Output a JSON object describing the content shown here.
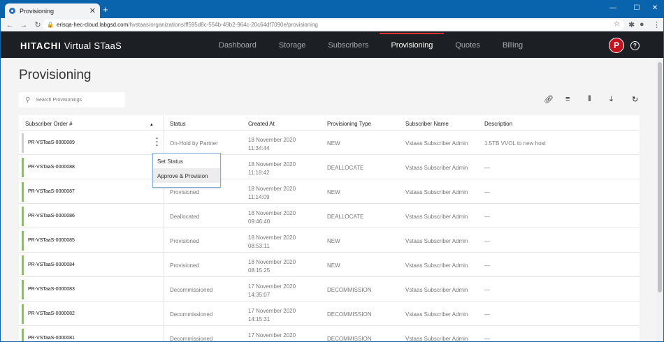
{
  "browser": {
    "tab_title": "Provisioning",
    "address_host": "erisqa-hec-cloud.labgsd.com",
    "address_path": "/hvstaas/organizations/ff595d8c-554b-49b2-964c-20c64df7090e/provisioning"
  },
  "app": {
    "brand": "HITACHI",
    "product": "Virtual STaaS",
    "nav": [
      "Dashboard",
      "Storage",
      "Subscribers",
      "Provisioning",
      "Quotes",
      "Billing"
    ],
    "active_nav": "Provisioning",
    "avatar_letter": "P",
    "help_glyph": "?"
  },
  "page": {
    "title": "Provisioning",
    "search_placeholder": "Search Provisionings"
  },
  "table": {
    "columns": [
      "Subscriber Order #",
      "Status",
      "Created At",
      "Provisioning Type",
      "Subscriber Name",
      "Description"
    ],
    "rows": [
      {
        "id": "PR-VSTaaS-0000089",
        "status": "On-Hold by Partner",
        "date": "18 November 2020",
        "time": "11:34:44",
        "type": "NEW",
        "subscriber": "Vstaas Subscriber Admin",
        "description": "1.5TB VVOL to new host"
      },
      {
        "id": "PR-VSTaaS-0000088",
        "status": "",
        "date": "18 November 2020",
        "time": "11:18:42",
        "type": "DEALLOCATE",
        "subscriber": "Vstaas Subscriber Admin",
        "description": "—"
      },
      {
        "id": "PR-VSTaaS-0000087",
        "status": "Provisioned",
        "date": "18 November 2020",
        "time": "11:14:09",
        "type": "NEW",
        "subscriber": "Vstaas Subscriber Admin",
        "description": "—"
      },
      {
        "id": "PR-VSTaaS-0000086",
        "status": "Deallocated",
        "date": "18 November 2020",
        "time": "09:46:40",
        "type": "DEALLOCATE",
        "subscriber": "Vstaas Subscriber Admin",
        "description": "—"
      },
      {
        "id": "PR-VSTaaS-0000085",
        "status": "Provisioned",
        "date": "18 November 2020",
        "time": "08:53:11",
        "type": "NEW",
        "subscriber": "Vstaas Subscriber Admin",
        "description": "—"
      },
      {
        "id": "PR-VSTaaS-0000084",
        "status": "Provisioned",
        "date": "18 November 2020",
        "time": "08:15:25",
        "type": "NEW",
        "subscriber": "Vstaas Subscriber Admin",
        "description": "—"
      },
      {
        "id": "PR-VSTaaS-0000083",
        "status": "Decommissioned",
        "date": "17 November 2020",
        "time": "14:35:07",
        "type": "DECOMMISSION",
        "subscriber": "Vstaas Subscriber Admin",
        "description": "—"
      },
      {
        "id": "PR-VSTaaS-0000082",
        "status": "Decommissioned",
        "date": "17 November 2020",
        "time": "14:15:31",
        "type": "DECOMMISSION",
        "subscriber": "Vstaas Subscriber Admin",
        "description": "—"
      },
      {
        "id": "PR-VSTaaS-0000081",
        "status": "Decommissioned",
        "date": "17 November 2020",
        "time": "",
        "type": "DECOMMISSION",
        "subscriber": "Vstaas Subscriber Admin",
        "description": "—"
      }
    ]
  },
  "context_menu": {
    "items": [
      "Set Status",
      "Approve & Provision"
    ],
    "highlighted": "Approve & Provision"
  },
  "colors": {
    "accent_red": "#e0312f",
    "status_green": "#8bc34a",
    "header_dark": "#1c1f24"
  }
}
